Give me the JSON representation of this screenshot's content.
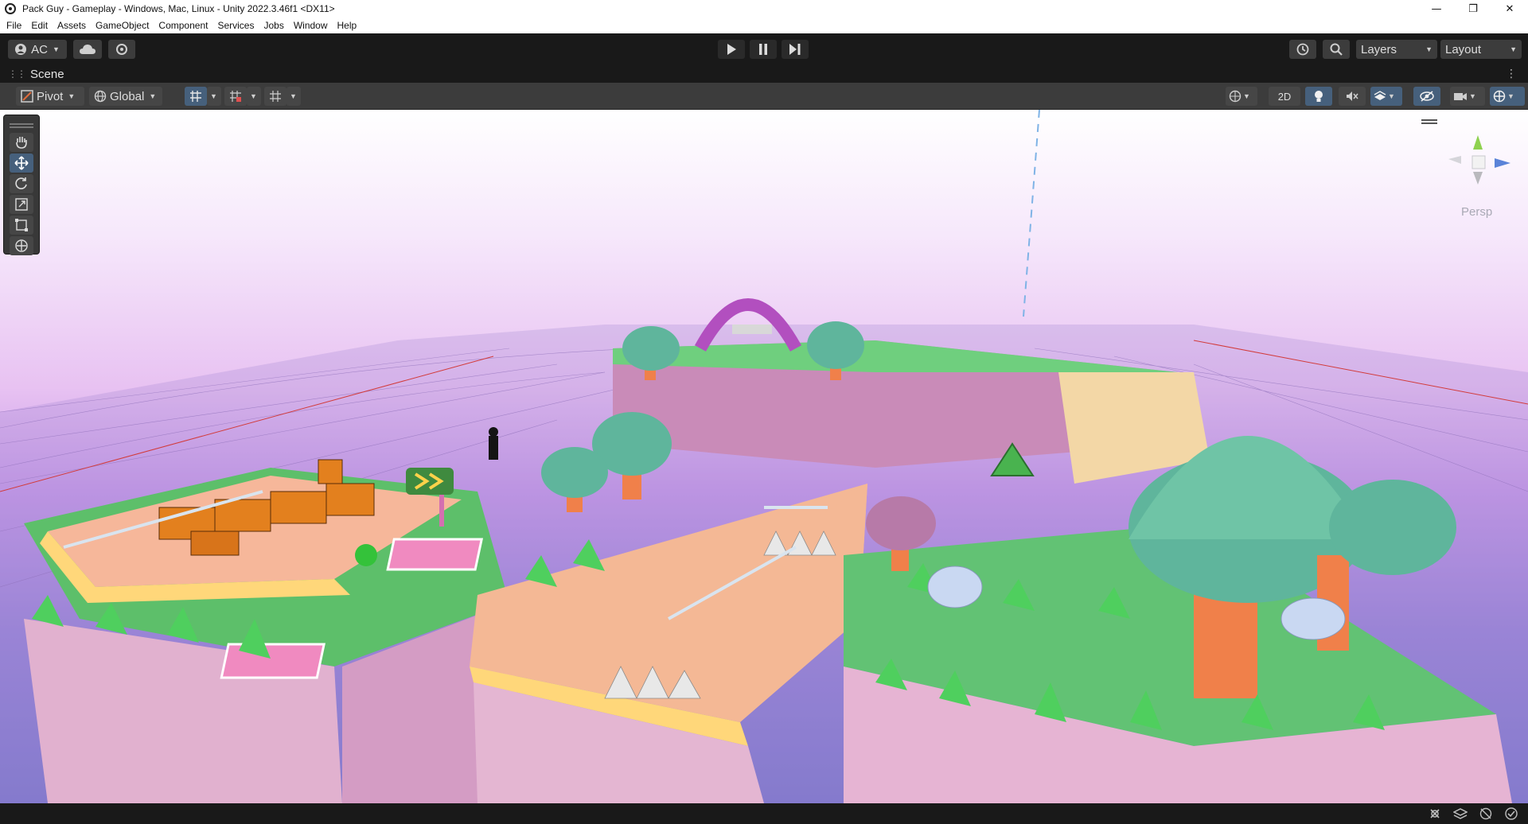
{
  "window": {
    "title": "Pack Guy - Gameplay - Windows, Mac, Linux - Unity 2022.3.46f1 <DX11>",
    "minimize": "—",
    "maximize": "❐",
    "close": "✕"
  },
  "menu": [
    "File",
    "Edit",
    "Assets",
    "GameObject",
    "Component",
    "Services",
    "Jobs",
    "Window",
    "Help"
  ],
  "toolbar": {
    "account_label": "AC",
    "layers_label": "Layers",
    "layout_label": "Layout"
  },
  "scene_tab": {
    "label": "Scene"
  },
  "scene_toolbar": {
    "pivot_label": "Pivot",
    "global_label": "Global",
    "mode_2d_label": "2D"
  },
  "viewport": {
    "projection_label": "Persp"
  },
  "colors": {
    "editor_dark": "#191919",
    "toolbar_grey": "#3c3c3c",
    "active_blue": "#46607c",
    "sky_pink": "#e8c2f2",
    "grass_green": "#5cc26e",
    "sand_peach": "#f2c79a",
    "cliff_pink": "#e6b8d6",
    "mushroom_teal": "#5fb59c"
  }
}
